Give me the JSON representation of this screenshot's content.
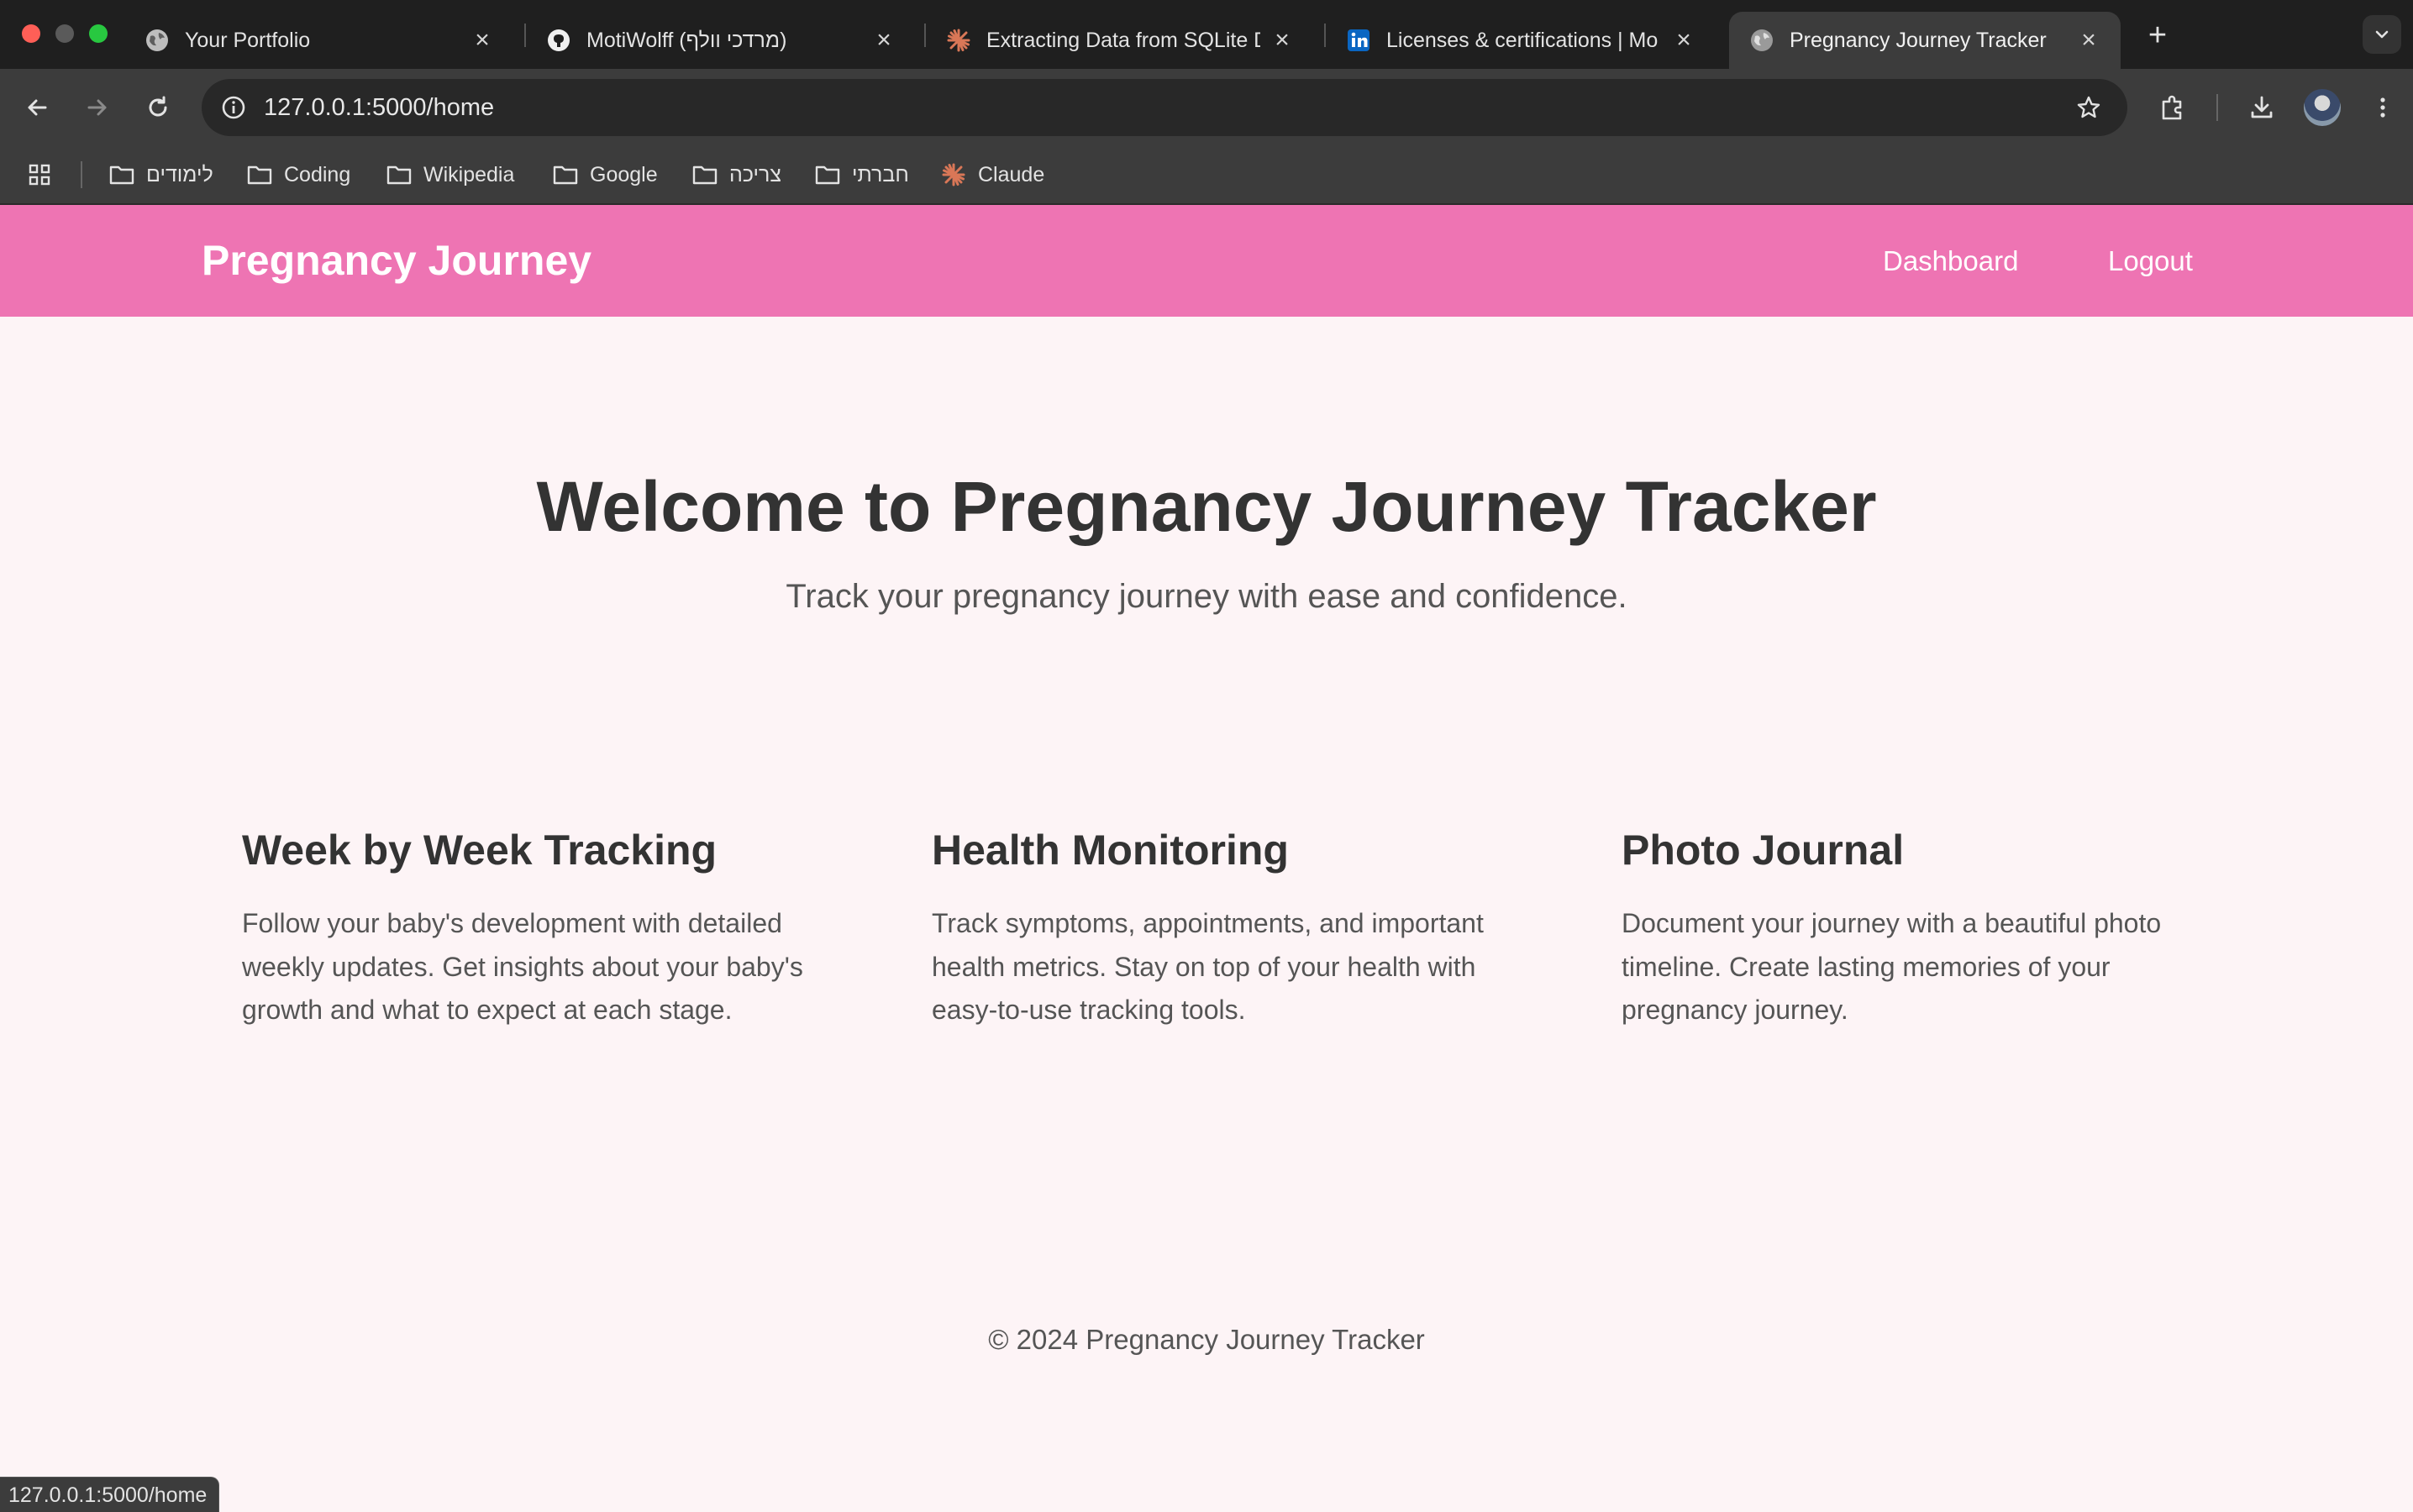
{
  "browser": {
    "tabs": [
      {
        "title": "Your Portfolio",
        "icon": "globe-icon"
      },
      {
        "title": "MotiWolff (מרדכי וולף)",
        "icon": "github-icon"
      },
      {
        "title": "Extracting Data from SQLite D",
        "icon": "claude-icon"
      },
      {
        "title": "Licenses & certifications | Mo",
        "icon": "linkedin-icon"
      },
      {
        "title": "Pregnancy Journey Tracker",
        "icon": "globe-icon",
        "active": true
      }
    ],
    "url": "127.0.0.1:5000/home",
    "bookmarks": [
      {
        "label": "לימודים",
        "icon": "folder-icon"
      },
      {
        "label": "Coding",
        "icon": "folder-icon"
      },
      {
        "label": "Wikipedia",
        "icon": "folder-icon"
      },
      {
        "label": "Google",
        "icon": "folder-icon"
      },
      {
        "label": "צריכה",
        "icon": "folder-icon"
      },
      {
        "label": "חברתי",
        "icon": "folder-icon"
      },
      {
        "label": "Claude",
        "icon": "claude-icon"
      }
    ],
    "status_url": "127.0.0.1:5000/home"
  },
  "site": {
    "brand": "Pregnancy Journey",
    "nav": {
      "dashboard": "Dashboard",
      "logout": "Logout"
    },
    "hero": {
      "title": "Welcome to Pregnancy Journey Tracker",
      "subtitle": "Track your pregnancy journey with ease and confidence."
    },
    "features": [
      {
        "title": "Week by Week Tracking",
        "text": "Follow your baby's development with detailed weekly updates. Get insights about your baby's growth and what to expect at each stage."
      },
      {
        "title": "Health Monitoring",
        "text": "Track symptoms, appointments, and important health metrics. Stay on top of your health with easy-to-use tracking tools."
      },
      {
        "title": "Photo Journal",
        "text": "Document your journey with a beautiful photo timeline. Create lasting memories of your pregnancy journey."
      }
    ],
    "footer": "© 2024 Pregnancy Journey Tracker"
  },
  "colors": {
    "nav_bg": "#ee74b3",
    "page_bg": "#fdf4f6",
    "text": "#333333",
    "muted_text": "#555555"
  }
}
